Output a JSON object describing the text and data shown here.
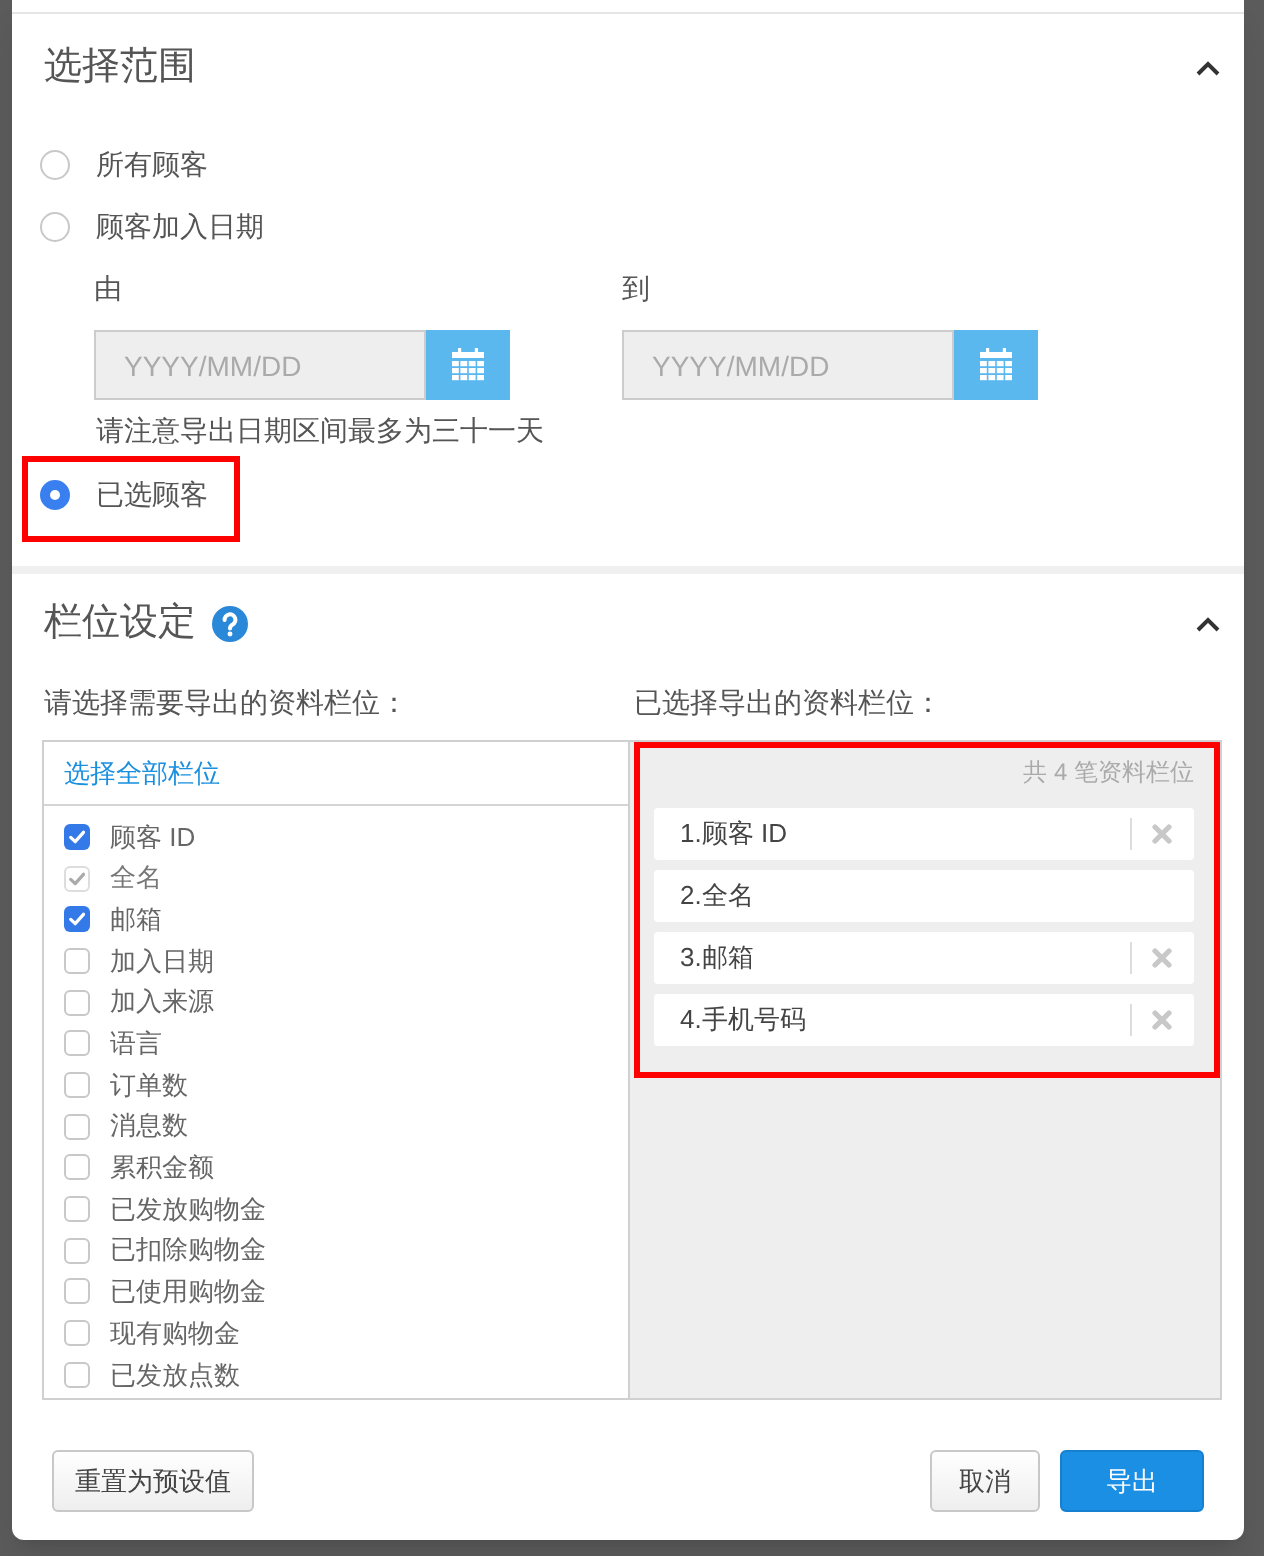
{
  "range_section": {
    "title": "选择范围",
    "expanded": true,
    "options": [
      {
        "label": "所有顾客",
        "selected": false,
        "highlighted": false
      },
      {
        "label": "顾客加入日期",
        "selected": false,
        "highlighted": false,
        "date_range": {
          "from_label": "由",
          "from_field": {
            "placeholder": "YYYY/MM/DD"
          },
          "to_label": "到",
          "to_field": {
            "placeholder": "YYYY/MM/DD"
          },
          "note": "请注意导出日期区间最多为三十一天"
        }
      },
      {
        "label": "已选顾客",
        "selected": true,
        "highlighted": true
      }
    ]
  },
  "fields_section": {
    "title": "栏位设定",
    "expanded": true,
    "available": {
      "heading": "请选择需要导出的资料栏位：",
      "select_all": "选择全部栏位",
      "items": [
        {
          "label": "顾客 ID",
          "checked": true,
          "disabled": false
        },
        {
          "label": "全名",
          "checked": true,
          "disabled": true
        },
        {
          "label": "邮箱",
          "checked": true,
          "disabled": false
        },
        {
          "label": "加入日期",
          "checked": false,
          "disabled": false
        },
        {
          "label": "加入来源",
          "checked": false,
          "disabled": false
        },
        {
          "label": "语言",
          "checked": false,
          "disabled": false
        },
        {
          "label": "订单数",
          "checked": false,
          "disabled": false
        },
        {
          "label": "消息数",
          "checked": false,
          "disabled": false
        },
        {
          "label": "累积金额",
          "checked": false,
          "disabled": false
        },
        {
          "label": "已发放购物金",
          "checked": false,
          "disabled": false
        },
        {
          "label": "已扣除购物金",
          "checked": false,
          "disabled": false
        },
        {
          "label": "已使用购物金",
          "checked": false,
          "disabled": false
        },
        {
          "label": "现有购物金",
          "checked": false,
          "disabled": false
        },
        {
          "label": "已发放点数",
          "checked": false,
          "disabled": false
        }
      ]
    },
    "selected": {
      "heading": "已选择导出的资料栏位：",
      "count": "共 4 笔资料栏位",
      "highlighted": true,
      "items": [
        {
          "label": "1.顾客 ID",
          "removable": true
        },
        {
          "label": "2.全名",
          "removable": false
        },
        {
          "label": "3.邮箱",
          "removable": true
        },
        {
          "label": "4.手机号码",
          "removable": true
        }
      ]
    }
  },
  "footer": {
    "reset_button": "重置为预设值",
    "cancel_button": "取消",
    "export_button": "导出"
  }
}
